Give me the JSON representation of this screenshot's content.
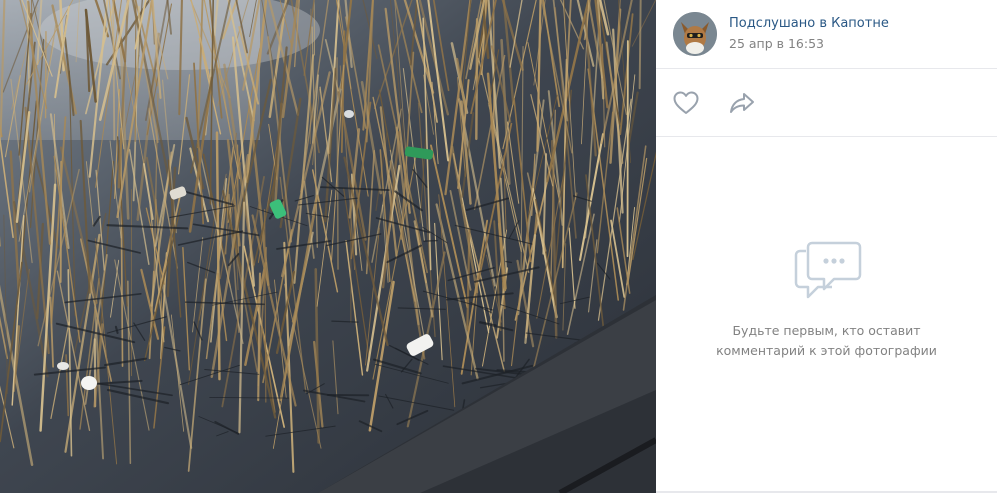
{
  "post": {
    "author_name": "Подслушано в Капотне",
    "date": "25 апр в 16:53"
  },
  "actions": {
    "like_icon": "heart-outline-icon",
    "share_icon": "share-arrow-icon"
  },
  "comments": {
    "icon": "speech-bubbles-icon",
    "empty_line1": "Будьте первым, кто оставит",
    "empty_line2": "комментарий к этой фотографии"
  },
  "colors": {
    "link": "#2a5885",
    "muted": "#828282",
    "icon_gray": "#99a2ad",
    "empty_icon": "#c5d0db",
    "divider": "#e7e8ec"
  }
}
